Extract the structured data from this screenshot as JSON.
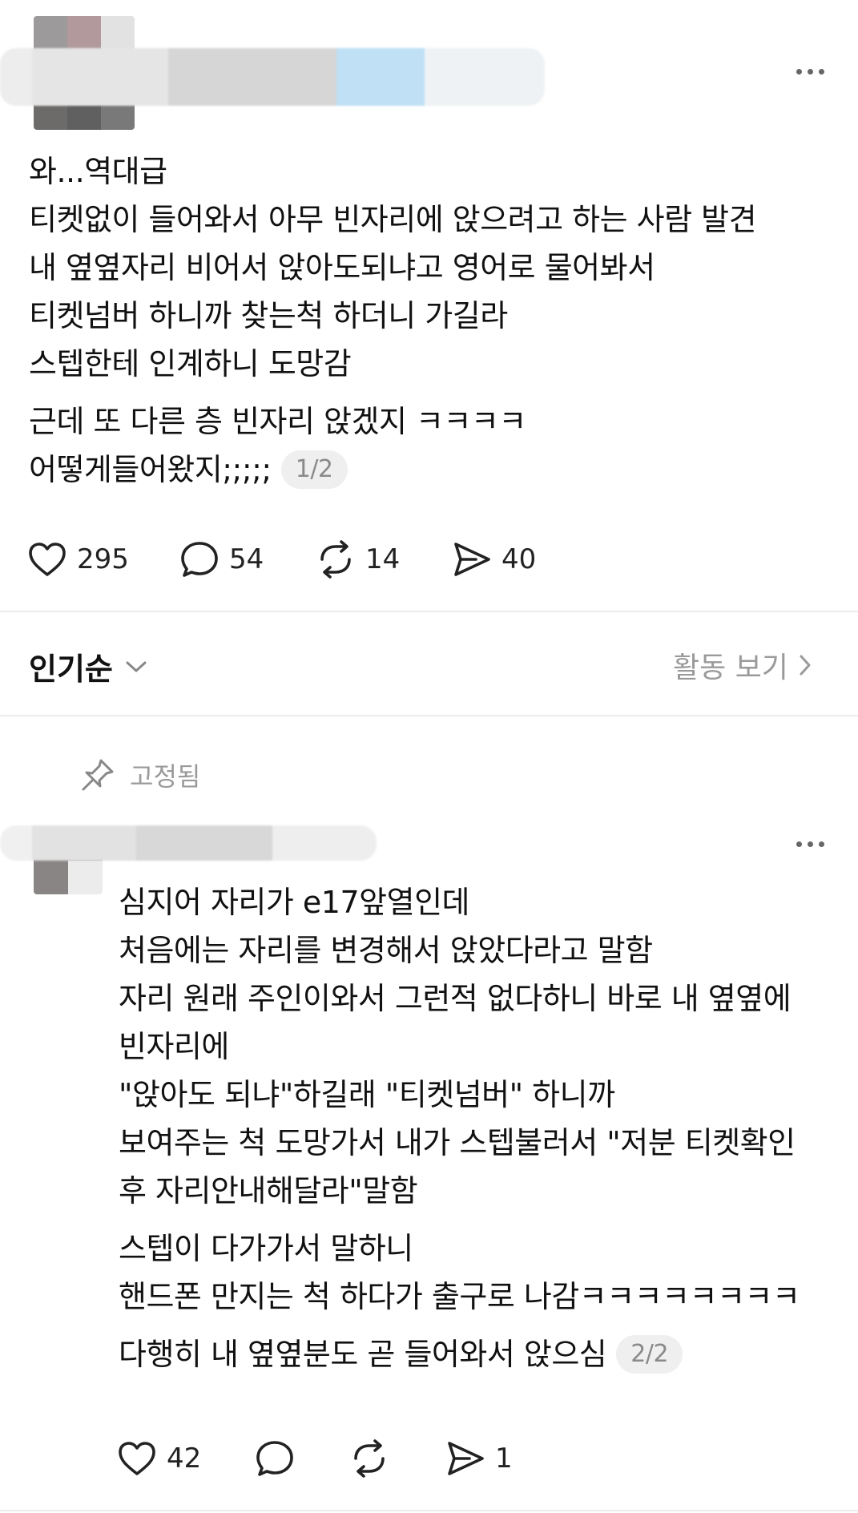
{
  "post": {
    "lines": [
      "와...역대급",
      "티켓없이 들어와서 아무 빈자리에 앉으려고 하는 사람 발견",
      "내 옆옆자리 비어서 앉아도되냐고 영어로 물어봐서",
      "티켓넘버 하니까 찾는척 하더니 가길라",
      "스텝한테 인계하니 도망감"
    ],
    "lines2": [
      "근데 또 다른 층 빈자리 앉겠지 ㅋㅋㅋㅋ",
      "어떻게들어왔지;;;;;"
    ],
    "thread_badge": "1/2",
    "actions": {
      "likes": "295",
      "comments": "54",
      "reposts": "14",
      "shares": "40"
    }
  },
  "sort": {
    "label": "인기순",
    "activity_label": "활동 보기"
  },
  "reply": {
    "pinned_label": "고정됨",
    "lines": [
      "심지어 자리가 e17앞열인데",
      "처음에는 자리를 변경해서 앉았다라고 말함",
      "자리 원래 주인이와서 그런적 없다하니 바로 내 옆옆에",
      "빈자리에",
      "\"앉아도 되냐\"하길래 \"티켓넘버\" 하니까",
      "보여주는 척 도망가서 내가 스텝불러서 \"저분 티켓확인",
      "후 자리안내해달라\"말함"
    ],
    "lines2": [
      "스텝이 다가가서 말하니",
      "핸드폰 만지는 척 하다가 출구로 나감ㅋㅋㅋㅋㅋㅋㅋㅋ"
    ],
    "lines3": [
      "다행히 내 옆옆분도 곧 들어와서 앉으심"
    ],
    "thread_badge": "2/2",
    "actions": {
      "likes": "42",
      "comments": "",
      "reposts": "",
      "shares": "1"
    }
  },
  "icons": {
    "more": "more-horizontal-icon",
    "like": "heart-icon",
    "comment": "comment-bubble-icon",
    "repost": "repost-icon",
    "share": "send-icon",
    "sort": "chevron-down-icon",
    "activity": "chevron-right-icon",
    "pin": "pin-icon"
  },
  "colors": {
    "text": "#111111",
    "muted": "#9a9a9a",
    "divider": "#ececec",
    "badge_bg": "#efefef"
  }
}
